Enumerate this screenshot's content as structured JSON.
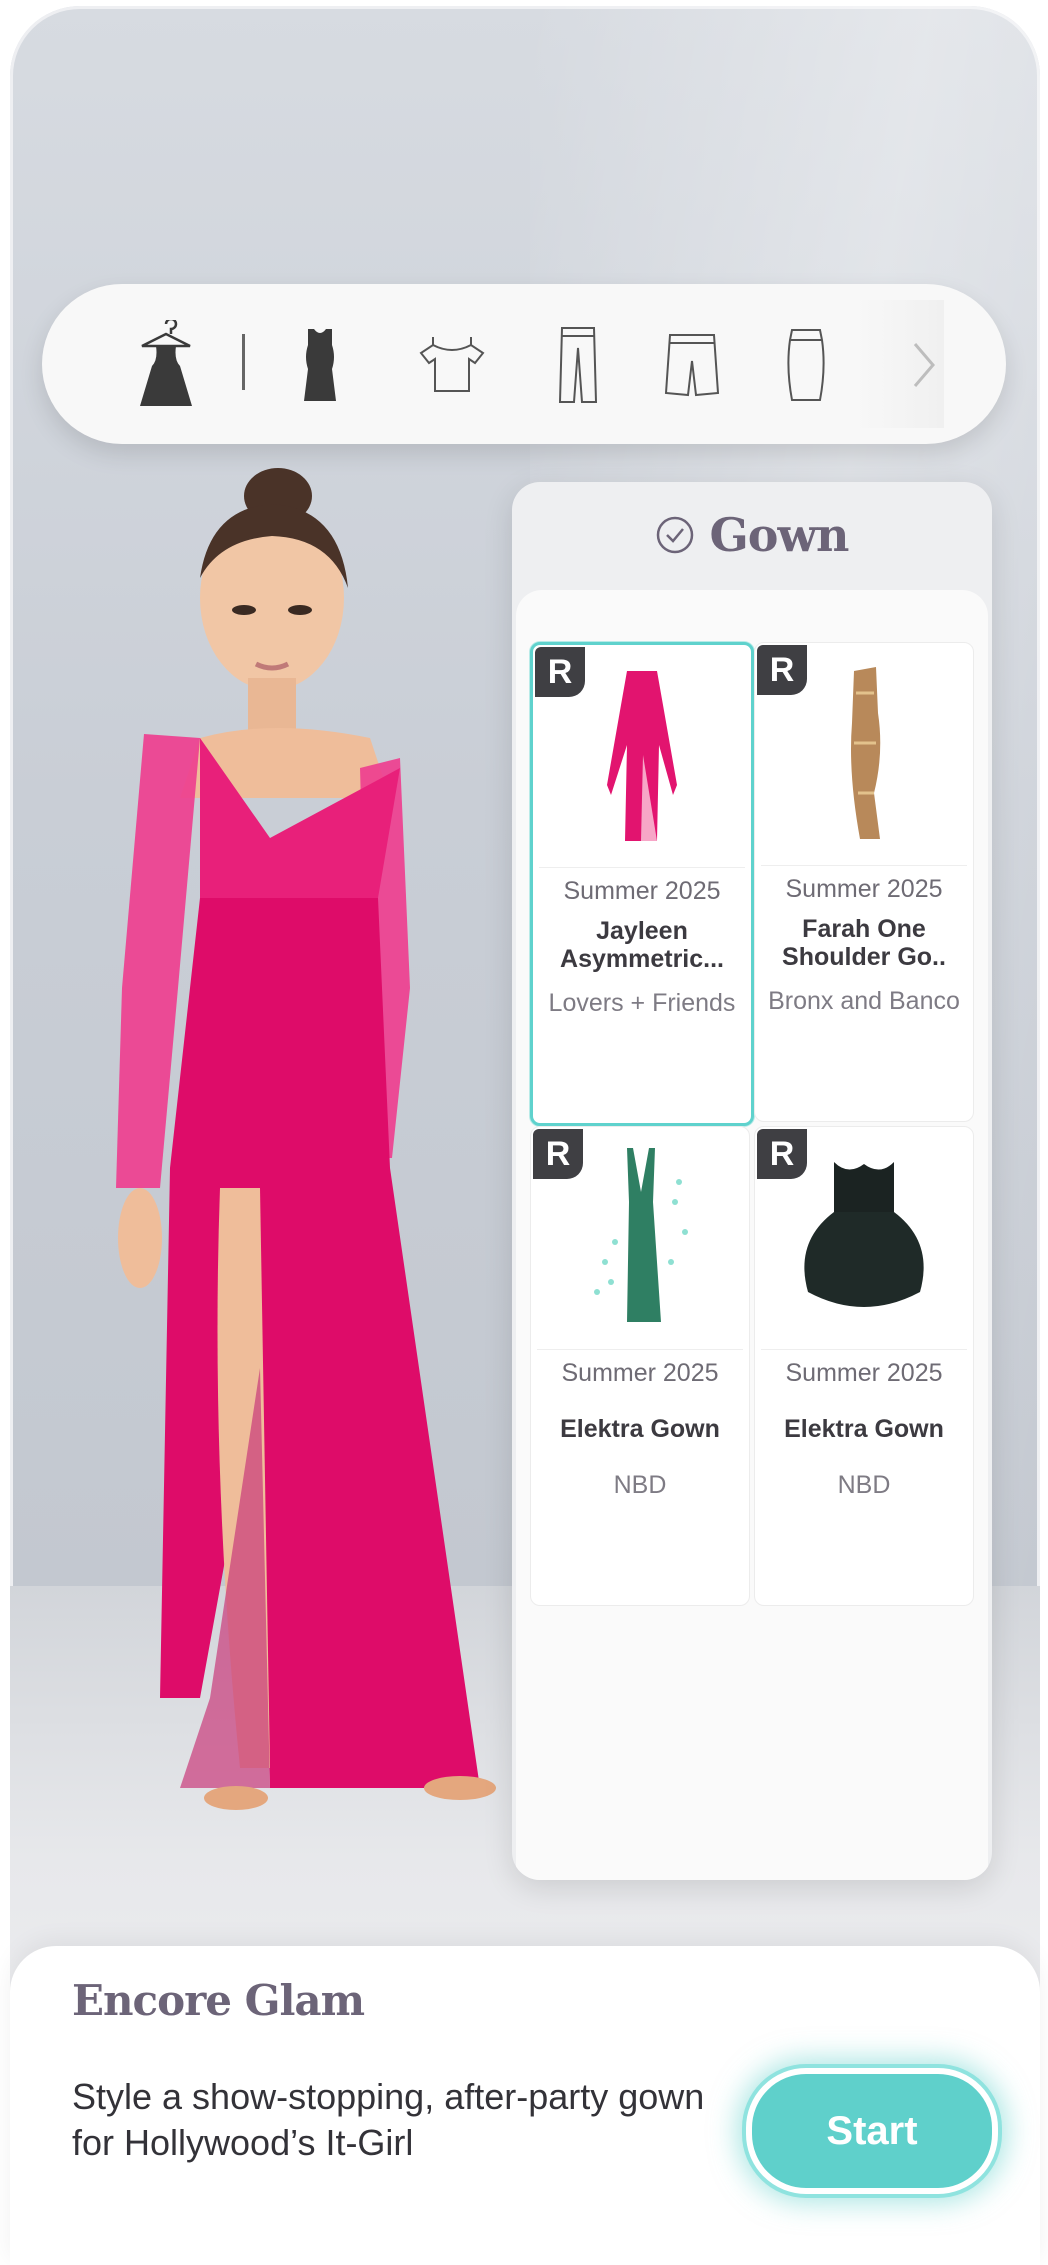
{
  "categories": [
    {
      "name": "dress-hanger-icon"
    },
    {
      "name": "bodycon-dress-icon"
    },
    {
      "name": "top-icon"
    },
    {
      "name": "pants-icon"
    },
    {
      "name": "shorts-icon"
    },
    {
      "name": "skirt-icon"
    },
    {
      "name": "chevron-right-icon"
    }
  ],
  "panel": {
    "title": "Gown",
    "items": [
      {
        "badge": "R",
        "season": "Summer 2025",
        "name": "Jayleen Asymmetric...",
        "brand": "Lovers + Friends",
        "selected": true,
        "color": "#e2146f"
      },
      {
        "badge": "R",
        "season": "Summer 2025",
        "name": "Farah One Shoulder Go..",
        "brand": "Bronx and Banco",
        "selected": false,
        "color": "#b8895a"
      },
      {
        "badge": "R",
        "season": "Summer 2025",
        "name": "Elektra Gown",
        "brand": "NBD",
        "selected": false,
        "color": "#2f7f63"
      },
      {
        "badge": "R",
        "season": "Summer 2025",
        "name": "Elektra Gown",
        "brand": "NBD",
        "selected": false,
        "color": "#1f2a28"
      }
    ]
  },
  "challenge": {
    "title": "Encore Glam",
    "description": "Style a show-stopping, after-party gown for Hollywood’s It-Girl",
    "start_label": "Start"
  },
  "colors": {
    "accent": "#5fd0cb",
    "dress": "#e0126d",
    "title": "#6c6478"
  }
}
